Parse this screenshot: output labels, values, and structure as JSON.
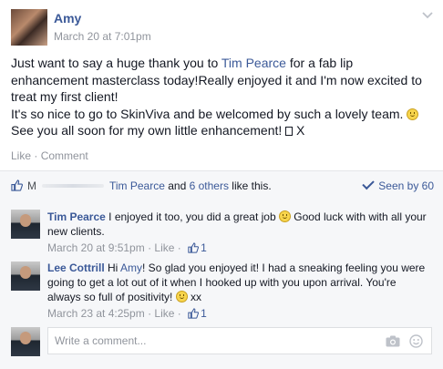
{
  "post": {
    "author": "Amy",
    "time": "March 20 at 7:01pm",
    "text": {
      "part1": "Just want to say a huge thank you to ",
      "mention": "Tim Pearce",
      "part2": " for a fab lip enhancement masterclass today!Really enjoyed it and I'm now excited to treat my first client!",
      "line2": "It's so nice to go to SkinViva and be welcomed by such a lovely team. ",
      "line3": "See you all soon for my own little enhancement! ",
      "line3_end": " X"
    },
    "actions": {
      "like": "Like",
      "sep": " · ",
      "comment": "Comment"
    }
  },
  "likes_bar": {
    "initial": "M",
    "name": "Tim Pearce",
    "mid": " and ",
    "others": "6 others",
    "tail": " like this.",
    "seen": "Seen by 60"
  },
  "comments": [
    {
      "name": "Tim Pearce",
      "text_a": " I enjoyed it too, you did a great job ",
      "text_b": " Good luck with with all your new clients.",
      "time": "March 20 at 9:51pm",
      "like": "Like",
      "like_count": "1"
    },
    {
      "name": "Lee Cottrill",
      "text_a": " Hi ",
      "mention": "Amy",
      "text_b": "! So glad you enjoyed it! I had a sneaking feeling you were going to get a lot out of it when I hooked up with you upon arrival. You're always so full of positivity! ",
      "text_c": " xx",
      "time": "March 23 at 4:25pm",
      "like": "Like",
      "like_count": "1"
    }
  ],
  "write_comment": {
    "placeholder": "Write a comment..."
  },
  "icons": {
    "chevron": "chevron-down-icon",
    "thumb": "thumbs-up-icon",
    "check": "check-icon",
    "camera": "camera-icon",
    "emoji": "emoji-icon",
    "smile": "smiley-emoji"
  },
  "colors": {
    "link": "#3b5998",
    "meta": "#90949c",
    "panel": "#f6f7f9",
    "border": "#e5e6e9"
  }
}
